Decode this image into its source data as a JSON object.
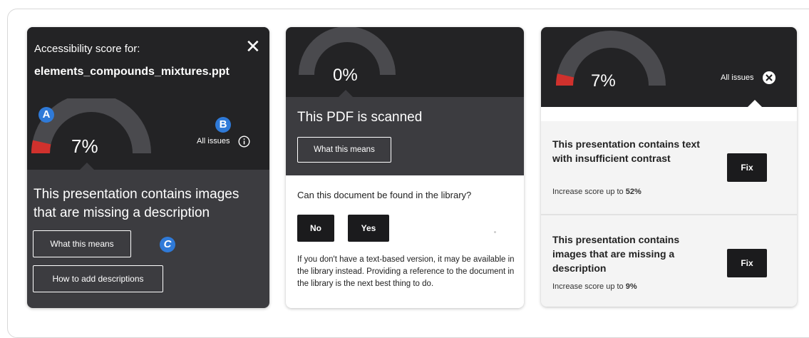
{
  "colors": {
    "dark": "#232325",
    "panel": "#3c3c40",
    "gauge_track": "#4a4a4e",
    "gauge_fill": "#d0312d",
    "badge": "#2f7ad8",
    "button_dark": "#1b1b1d"
  },
  "card1": {
    "title": "Accessibility score for:",
    "filename": "elements_compounds_mixtures.ppt",
    "close_glyph": "✕",
    "score": "7%",
    "score_fraction": 0.07,
    "all_issues": "All issues",
    "badges": {
      "a": "A",
      "b": "B",
      "c": "C"
    },
    "message": "This presentation contains images that are missing a description",
    "what_this_means": "What this means",
    "how_to_add": "How to add descriptions"
  },
  "card2": {
    "score": "0%",
    "score_fraction": 0.0,
    "heading": "This PDF is scanned",
    "what_this_means": "What this means",
    "question": "Can this document be found in the library?",
    "no": "No",
    "yes": "Yes",
    "note": "If you don't have a text-based version, it may be available in the library instead. Providing a reference to the document in the library is the next best thing to do."
  },
  "card3": {
    "score": "7%",
    "score_fraction": 0.07,
    "all_issues": "All issues",
    "issues": [
      {
        "text": "This presentation contains text with insufficient contrast",
        "sub_prefix": "Increase score up to ",
        "sub_value": "52%",
        "fix": "Fix"
      },
      {
        "text": "This presentation contains images that are missing a description",
        "sub_prefix": "Increase score up to ",
        "sub_value": "9%",
        "fix": "Fix"
      }
    ]
  }
}
